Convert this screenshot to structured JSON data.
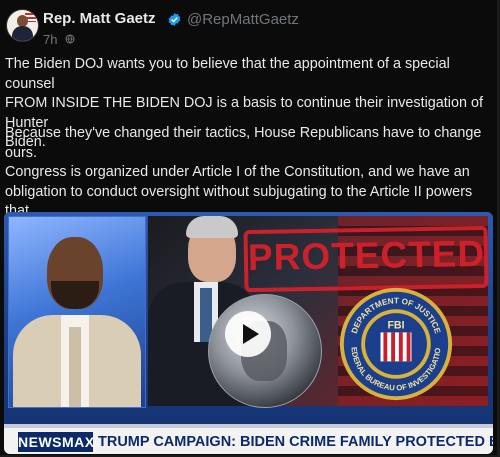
{
  "author": {
    "name": "Rep. Matt Gaetz",
    "handle": "@RepMattGaetz",
    "verified": true,
    "time": "7h",
    "avatar_icon": "profile-avatar",
    "visibility_icon": "globe-icon"
  },
  "post": {
    "paragraph1": "The Biden DOJ wants you to believe that the appointment of a special counsel\nFROM INSIDE THE BIDEN DOJ is a basis to continue their investigation of Hunter\nBiden.",
    "paragraph2": "Because they've changed their tactics, House Republicans have to change ours.\nCongress is organized under Article I of the Constitution, and we have an\nobligation to conduct oversight without subjugating to the Article II powers that\nthe DOJ is acting on."
  },
  "video": {
    "stamp_text": "PROTECTED",
    "seal_top": "DEPARTMENT OF JUSTICE",
    "seal_bottom": "FEDERAL BUREAU OF INVESTIGATION",
    "seal_center": "FBI",
    "network": "NEWSMAX",
    "ticker": "TRUMP CAMPAIGN: BIDEN CRIME FAMILY PROTECTED BY DOJ FOR DECADES",
    "play_icon": "play-icon"
  },
  "colors": {
    "background": "#0b0b0b",
    "text": "#e7e9ea",
    "muted": "#71767b",
    "verified": "#1d9bf0",
    "stamp": "#d3212b",
    "newsmax_blue": "#0c2a6b"
  }
}
